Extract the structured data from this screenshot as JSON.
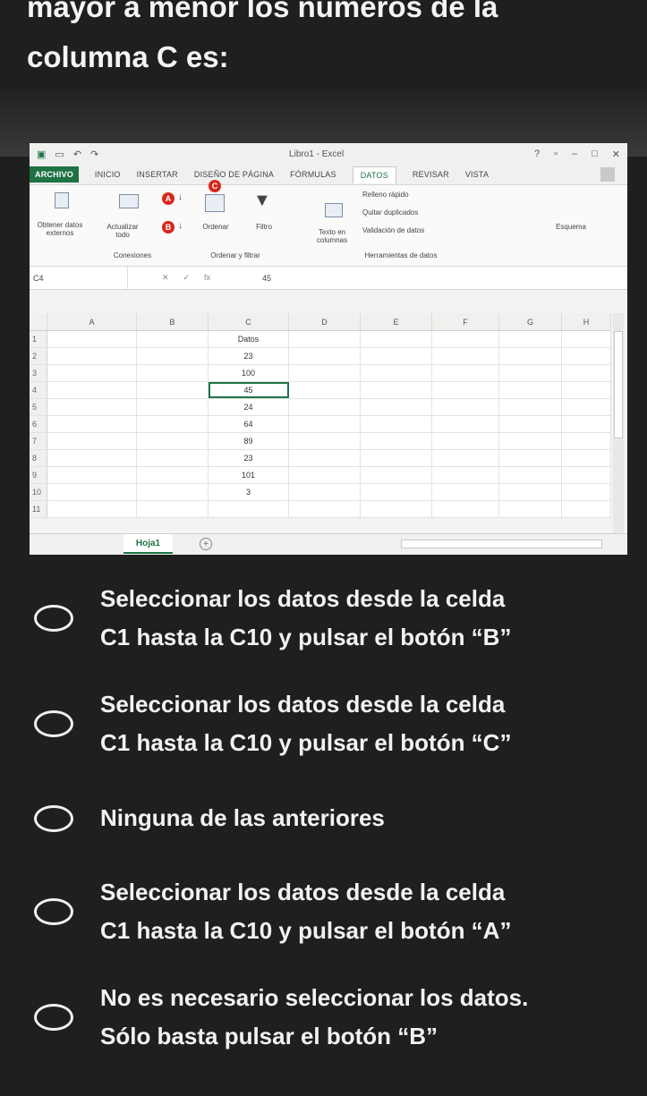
{
  "question": {
    "line1": "mayor a menor los números de la",
    "line2": "columna C es:"
  },
  "excel": {
    "window_title": "Libro1 - Excel",
    "help": "?",
    "menu": [
      "ARCHIVO",
      "INICIO",
      "INSERTAR",
      "DISEÑO DE PÁGINA",
      "FÓRMULAS",
      "DATOS",
      "REVISAR",
      "VISTA"
    ],
    "ribbon": {
      "obtener": "Obtener datos externos",
      "actualizar": "Actualizar todo",
      "conexiones": "Conexiones",
      "ordenar": "Ordenar",
      "filtro": "Filtro",
      "ordenar_filtrar": "Ordenar y filtrar",
      "texto_columnas": "Texto en columnas",
      "relleno": "Relleno rápido",
      "quitar": "Quitar duplicados",
      "validacion": "Validación de datos",
      "herramientas": "Herramientas de datos",
      "esquema": "Esquema",
      "marker_a": "A",
      "marker_b": "B",
      "marker_c": "C"
    },
    "name_box": "C4",
    "formula_value": "45",
    "columns": [
      "A",
      "B",
      "C",
      "D",
      "E",
      "F",
      "G",
      "H"
    ],
    "rows": [
      {
        "n": "1",
        "c": "Datos"
      },
      {
        "n": "2",
        "c": "23"
      },
      {
        "n": "3",
        "c": "100"
      },
      {
        "n": "4",
        "c": "45"
      },
      {
        "n": "5",
        "c": "24"
      },
      {
        "n": "6",
        "c": "64"
      },
      {
        "n": "7",
        "c": "89"
      },
      {
        "n": "8",
        "c": "23"
      },
      {
        "n": "9",
        "c": "101"
      },
      {
        "n": "10",
        "c": "3"
      },
      {
        "n": "11",
        "c": ""
      }
    ],
    "sheet_tab": "Hoja1",
    "add_sheet": "+"
  },
  "options": [
    {
      "line1": "Seleccionar los datos desde la celda",
      "line2": "C1 hasta la C10 y pulsar el botón “B”"
    },
    {
      "line1": "Seleccionar los datos desde la celda",
      "line2": "C1 hasta la C10 y pulsar el botón “C”"
    },
    {
      "line1": "Ninguna de las anteriores",
      "line2": ""
    },
    {
      "line1": "Seleccionar los datos desde la celda",
      "line2": "C1 hasta la C10 y pulsar el botón “A”"
    },
    {
      "line1": "No es necesario seleccionar los datos.",
      "line2": "Sólo basta pulsar el botón “B”"
    }
  ]
}
